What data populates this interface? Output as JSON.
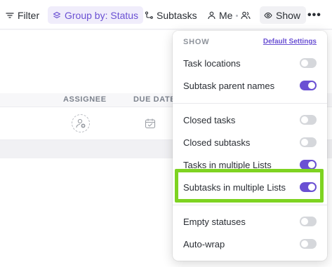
{
  "toolbar": {
    "filter_label": "Filter",
    "group_label": "Group by: Status",
    "subtasks_label": "Subtasks",
    "me_label": "Me",
    "show_label": "Show"
  },
  "table": {
    "columns": [
      "ASSIGNEE",
      "DUE DATE"
    ]
  },
  "show_panel": {
    "title": "SHOW",
    "default_link": "Default Settings",
    "options": [
      {
        "label": "Task locations",
        "on": false
      },
      {
        "label": "Subtask parent names",
        "on": true
      },
      {
        "label": "Closed tasks",
        "on": false
      },
      {
        "label": "Closed subtasks",
        "on": false
      },
      {
        "label": "Tasks in multiple Lists",
        "on": true
      },
      {
        "label": "Subtasks in multiple Lists",
        "on": true
      },
      {
        "label": "Empty statuses",
        "on": false
      },
      {
        "label": "Auto-wrap",
        "on": false
      }
    ]
  },
  "colors": {
    "accent": "#6a50d3",
    "highlight": "#7ed321"
  }
}
